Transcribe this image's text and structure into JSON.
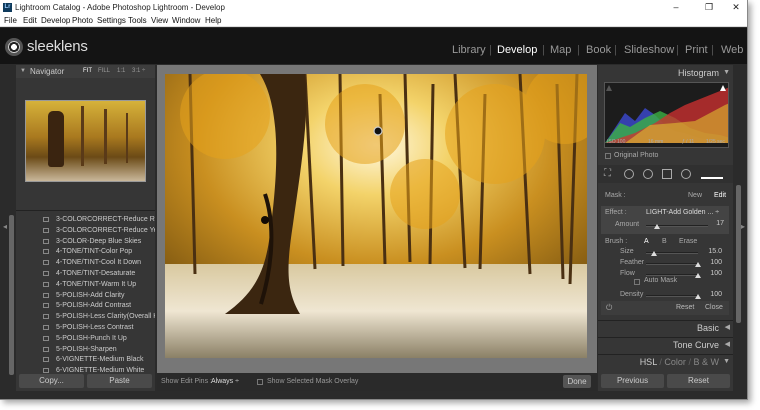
{
  "window": {
    "title": "Lightroom Catalog - Adobe Photoshop Lightroom - Develop",
    "app_icon": "Lr",
    "controls": [
      "–",
      "❐",
      "✕"
    ]
  },
  "menu": [
    "File",
    "Edit",
    "Develop",
    "Photo",
    "Settings",
    "Tools",
    "View",
    "Window",
    "Help"
  ],
  "brand": {
    "name": "sleeklens"
  },
  "modules": [
    {
      "label": "Library",
      "active": false
    },
    {
      "label": "Develop",
      "active": true
    },
    {
      "label": "Map",
      "active": false
    },
    {
      "label": "Book",
      "active": false
    },
    {
      "label": "Slideshow",
      "active": false
    },
    {
      "label": "Print",
      "active": false
    },
    {
      "label": "Web",
      "active": false
    }
  ],
  "navigator": {
    "title": "Navigator",
    "zoom_options": [
      "FIT",
      "FILL",
      "1:1",
      "3:1 ÷"
    ]
  },
  "presets": [
    "3-COLORCORRECT-Reduce Reds",
    "3-COLORCORRECT-Reduce Yell...",
    "3-COLOR-Deep Blue Skies",
    "4-TONE/TINT-Color Pop",
    "4-TONE/TINT-Cool It Down",
    "4-TONE/TINT-Desaturate",
    "4-TONE/TINT-Warm It Up",
    "5-POLISH-Add Clarity",
    "5-POLISH-Add Contrast",
    "5-POLISH-Less Clarity(Overall H...",
    "5-POLISH-Less Contrast",
    "5-POLISH-Punch It Up",
    "5-POLISH-Sharpen",
    "6-VIGNETTE-Medium Black",
    "6-VIGNETTE-Medium White"
  ],
  "left_buttons": {
    "copy": "Copy...",
    "paste": "Paste"
  },
  "toolbar": {
    "edit_pins_label": "Show Edit Pins :",
    "edit_pins_value": "Always ÷",
    "mask_overlay_label": "Show Selected Mask Overlay",
    "done": "Done"
  },
  "histogram": {
    "title": "Histogram",
    "iso": "ISO 100",
    "focal": "16 mm",
    "aperture": "ƒ / 11",
    "shutter": "1/25 sec",
    "original_photo": "Original Photo"
  },
  "mask": {
    "label": "Mask :",
    "new": "New",
    "edit": "Edit",
    "effect_label": "Effect :",
    "effect_value": "LIGHT-Add Golden ... ÷",
    "amount_label": "Amount",
    "amount_value": "17",
    "amount_level": 0.17,
    "brush_label": "Brush :",
    "brush_a": "A",
    "brush_b": "B",
    "erase": "Erase",
    "sliders": [
      {
        "label": "Size",
        "value": "15.0",
        "level": 0.15
      },
      {
        "label": "Feather",
        "value": "100",
        "level": 1.0
      },
      {
        "label": "Flow",
        "value": "100",
        "level": 1.0
      },
      {
        "label": "Density",
        "value": "100",
        "level": 1.0
      }
    ],
    "auto_mask": "Auto Mask",
    "reset": "Reset",
    "close": "Close"
  },
  "panels": {
    "basic": "Basic",
    "tone_curve": "Tone Curve",
    "hsl": "HSL",
    "color": "Color",
    "bw": "B & W",
    "sep1": "/",
    "sep2": "/"
  },
  "right_buttons": {
    "previous": "Previous",
    "reset": "Reset"
  },
  "colors": {
    "active_module": "#ffffff",
    "inactive_module": "#999999",
    "panel_bg": "#363636"
  }
}
